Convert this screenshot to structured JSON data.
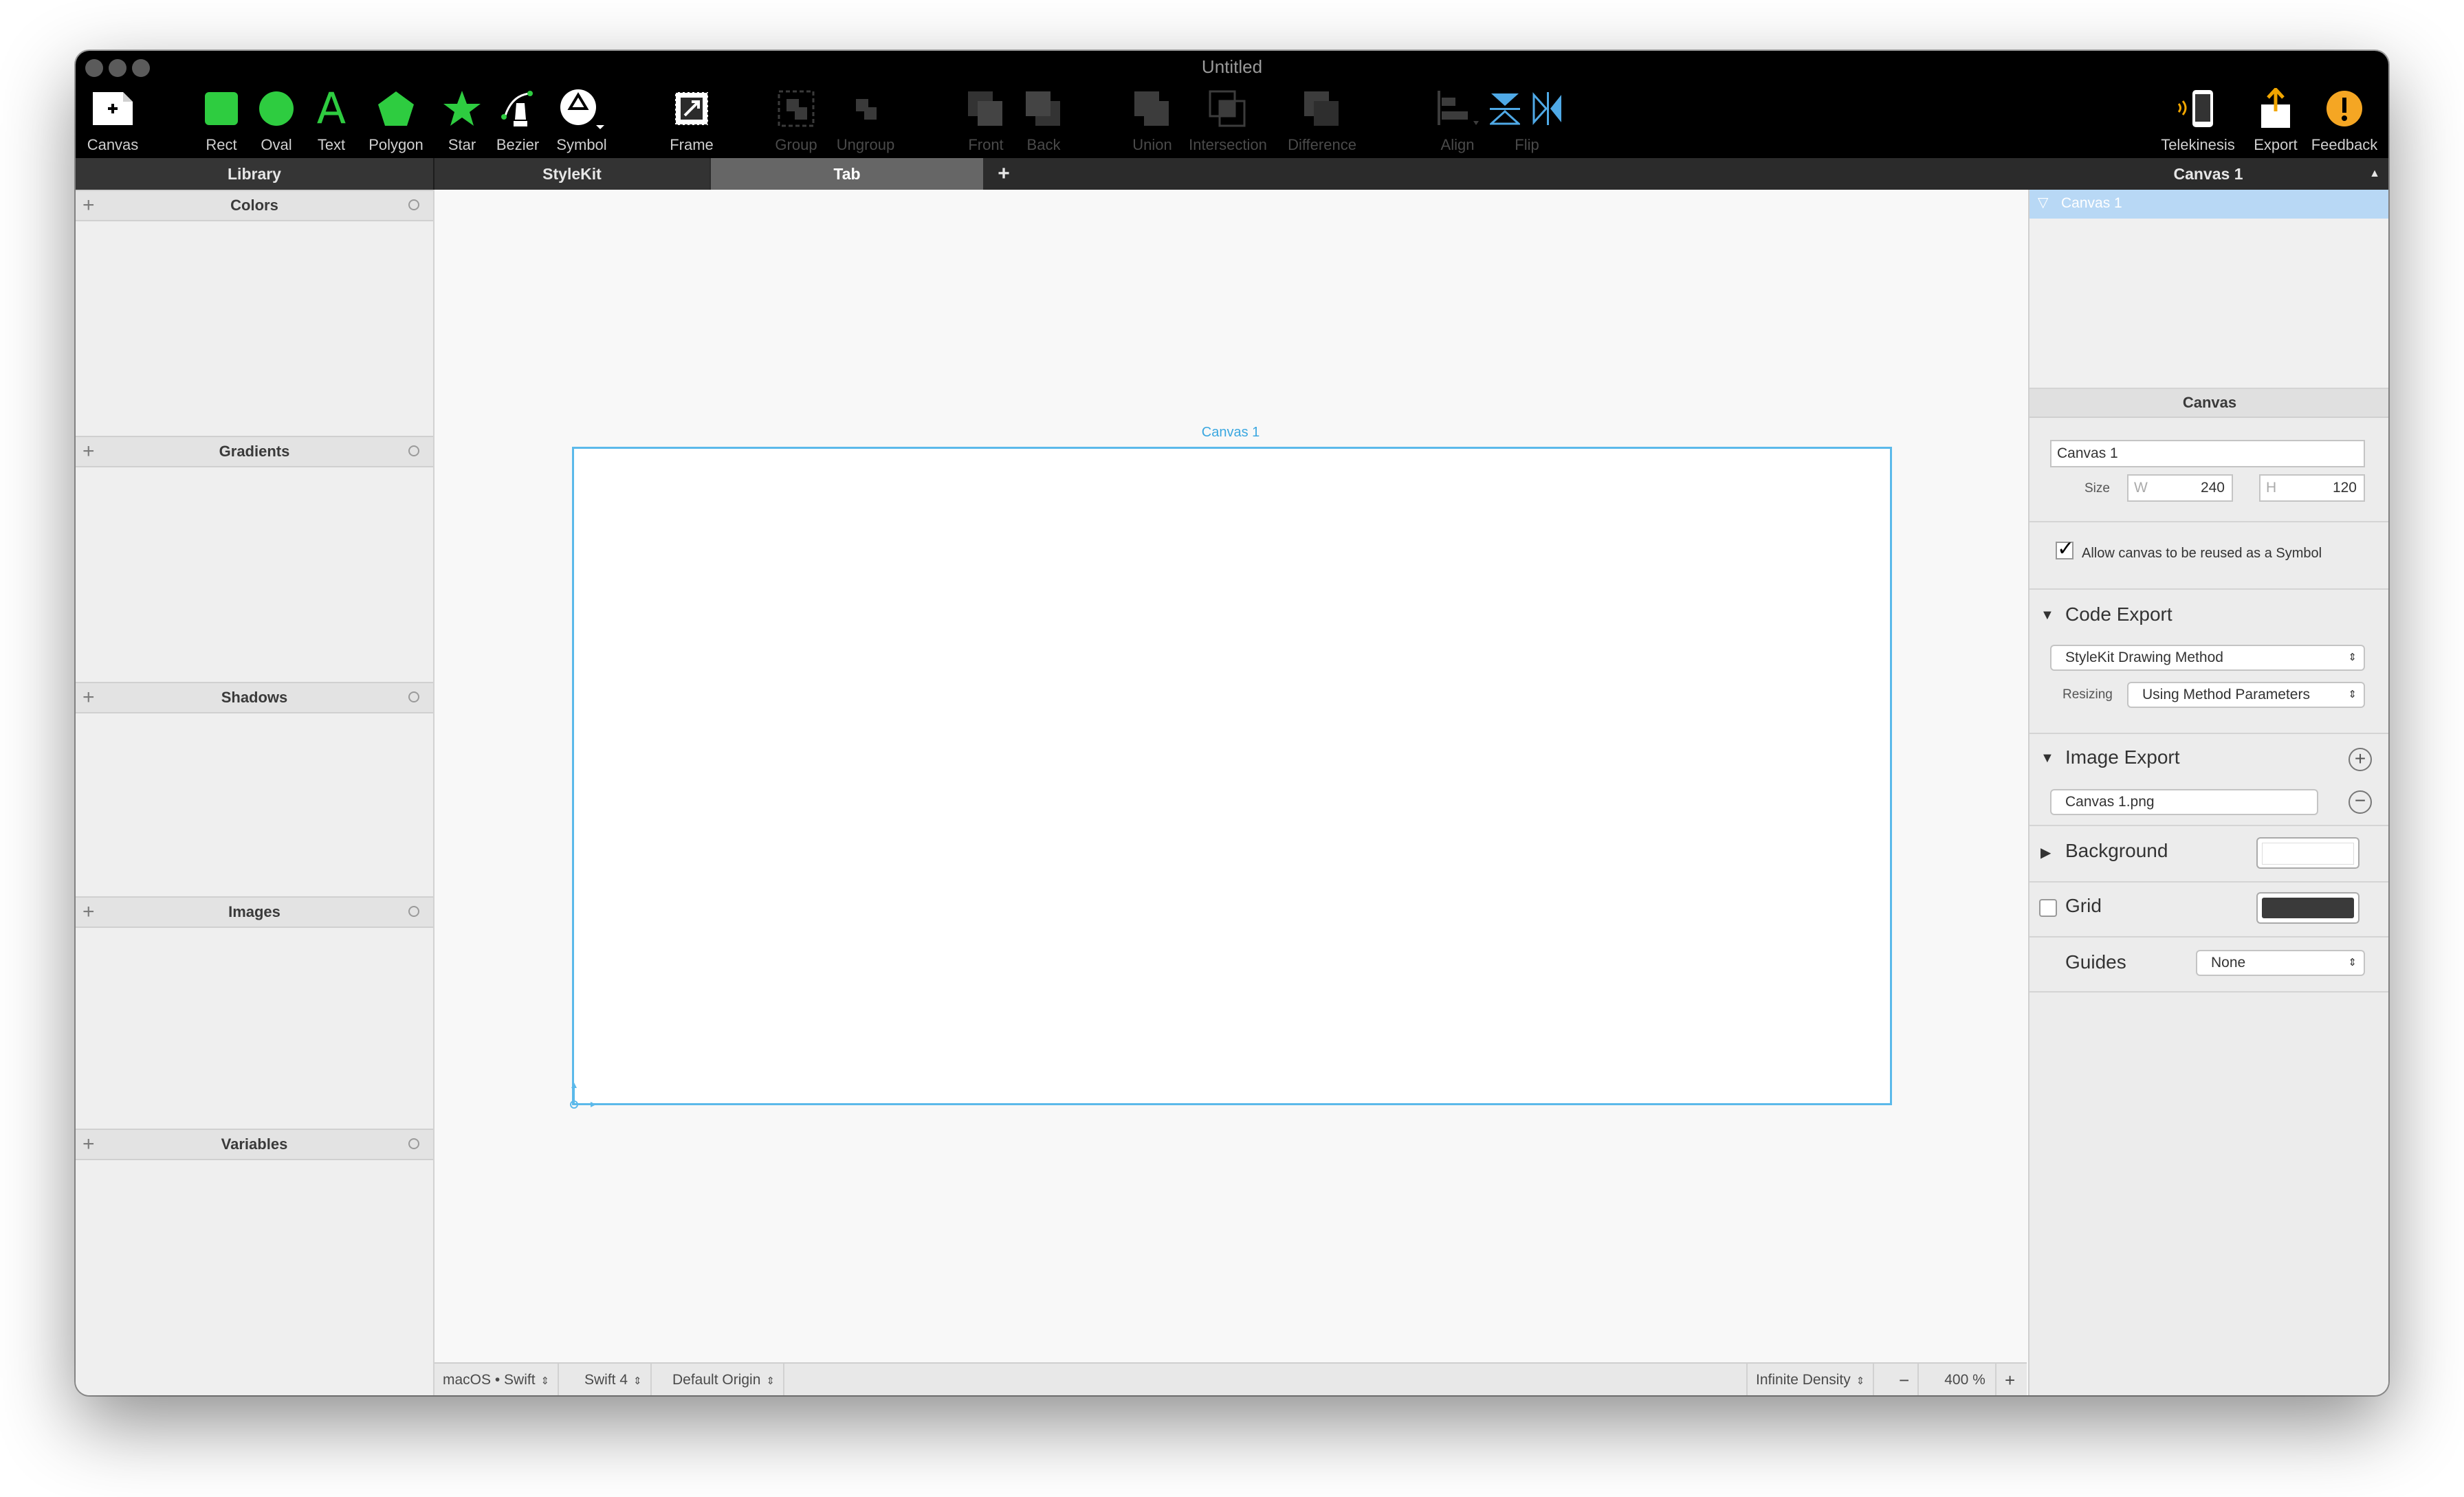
{
  "window": {
    "title": "Untitled"
  },
  "toolbar": {
    "items": [
      {
        "label": "Canvas"
      },
      {
        "label": "Rect"
      },
      {
        "label": "Oval"
      },
      {
        "label": "Text"
      },
      {
        "label": "Polygon"
      },
      {
        "label": "Star"
      },
      {
        "label": "Bezier"
      },
      {
        "label": "Symbol"
      },
      {
        "label": "Frame"
      },
      {
        "label": "Group"
      },
      {
        "label": "Ungroup"
      },
      {
        "label": "Front"
      },
      {
        "label": "Back"
      },
      {
        "label": "Union"
      },
      {
        "label": "Intersection"
      },
      {
        "label": "Difference"
      },
      {
        "label": "Align"
      },
      {
        "label": "Flip"
      },
      {
        "label": "Telekinesis"
      },
      {
        "label": "Export"
      },
      {
        "label": "Feedback"
      }
    ],
    "text_glyph": "A",
    "accent_green": "#2ecc40"
  },
  "tabs": {
    "library": "Library",
    "stylekit": "StyleKit",
    "tab": "Tab",
    "add": "+"
  },
  "library": {
    "sections": [
      "Colors",
      "Gradients",
      "Shadows",
      "Images",
      "Variables"
    ],
    "add_glyph": "+"
  },
  "canvas": {
    "artboard_label": "Canvas 1",
    "border_color": "#5bb9ea"
  },
  "status": {
    "platform": "macOS • Swift",
    "swift_version": "Swift 4",
    "origin": "Default Origin",
    "density": "Infinite Density",
    "zoom_minus": "−",
    "zoom": "400 %",
    "zoom_plus": "+"
  },
  "inspector": {
    "header": "Canvas 1",
    "tree_item": "Canvas 1",
    "section_title": "Canvas",
    "name_value": "Canvas 1",
    "size_label": "Size",
    "w_label": "W",
    "w_value": "240",
    "h_label": "H",
    "h_value": "120",
    "symbol_checkbox": "Allow canvas to be reused as a Symbol",
    "code_export_title": "Code Export",
    "code_method": "StyleKit Drawing Method",
    "resizing_label": "Resizing",
    "resizing_value": "Using Method Parameters",
    "image_export_title": "Image Export",
    "image_export_file": "Canvas 1.png",
    "background_title": "Background",
    "grid_title": "Grid",
    "guides_title": "Guides",
    "guides_value": "None"
  }
}
